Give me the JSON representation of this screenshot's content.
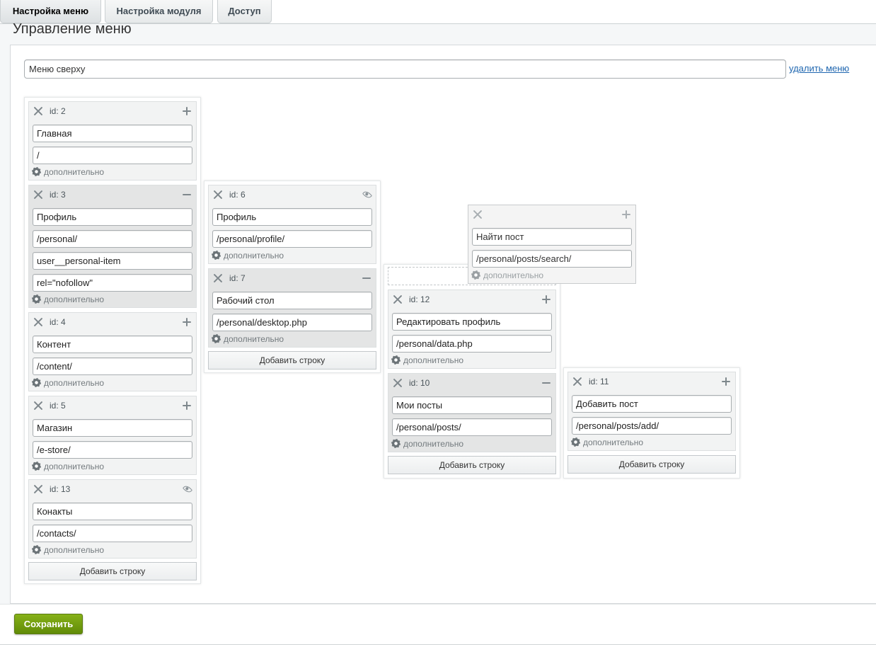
{
  "tabs": [
    {
      "label": "Настройка меню",
      "active": true
    },
    {
      "label": "Настройка модуля",
      "active": false
    },
    {
      "label": "Доступ",
      "active": false
    }
  ],
  "section_title": "Управление меню",
  "menu_name": {
    "value": "Меню сверху"
  },
  "delete_menu": "удалить меню",
  "extra_label": "дополнительно",
  "add_row_label": "Добавить строку",
  "save_label": "Сохранить",
  "items": {
    "i2": {
      "id": "id: 2",
      "action": "plus-icon",
      "fields": [
        "Главная",
        "/"
      ]
    },
    "i3": {
      "id": "id: 3",
      "action": "minus-icon",
      "fields": [
        "Профиль",
        "/personal/",
        "user__personal-item",
        "rel=\"nofollow\""
      ]
    },
    "i4": {
      "id": "id: 4",
      "action": "plus-icon",
      "fields": [
        "Контент",
        "/content/"
      ]
    },
    "i5": {
      "id": "id: 5",
      "action": "plus-icon",
      "fields": [
        "Магазин",
        "/e-store/"
      ]
    },
    "i13": {
      "id": "id: 13",
      "action": "eye-icon",
      "fields": [
        "Конакты",
        "/contacts/"
      ]
    },
    "i6": {
      "id": "id: 6",
      "action": "eye-icon",
      "fields": [
        "Профиль",
        "/personal/profile/"
      ]
    },
    "i7": {
      "id": "id: 7",
      "action": "minus-icon",
      "fields": [
        "Рабочий стол",
        "/personal/desktop.php"
      ]
    },
    "i12": {
      "id": "id: 12",
      "action": "plus-icon",
      "fields": [
        "Редактировать профиль",
        "/personal/data.php"
      ]
    },
    "i10": {
      "id": "id: 10",
      "action": "minus-icon",
      "fields": [
        "Мои посты",
        "/personal/posts/"
      ]
    },
    "i11": {
      "id": "id: 11",
      "action": "plus-icon",
      "fields": [
        "Добавить пост",
        "/personal/posts/add/"
      ]
    },
    "dragged": {
      "action": "plus-icon",
      "fields": [
        "Найти пост",
        "/personal/posts/search/"
      ]
    }
  }
}
